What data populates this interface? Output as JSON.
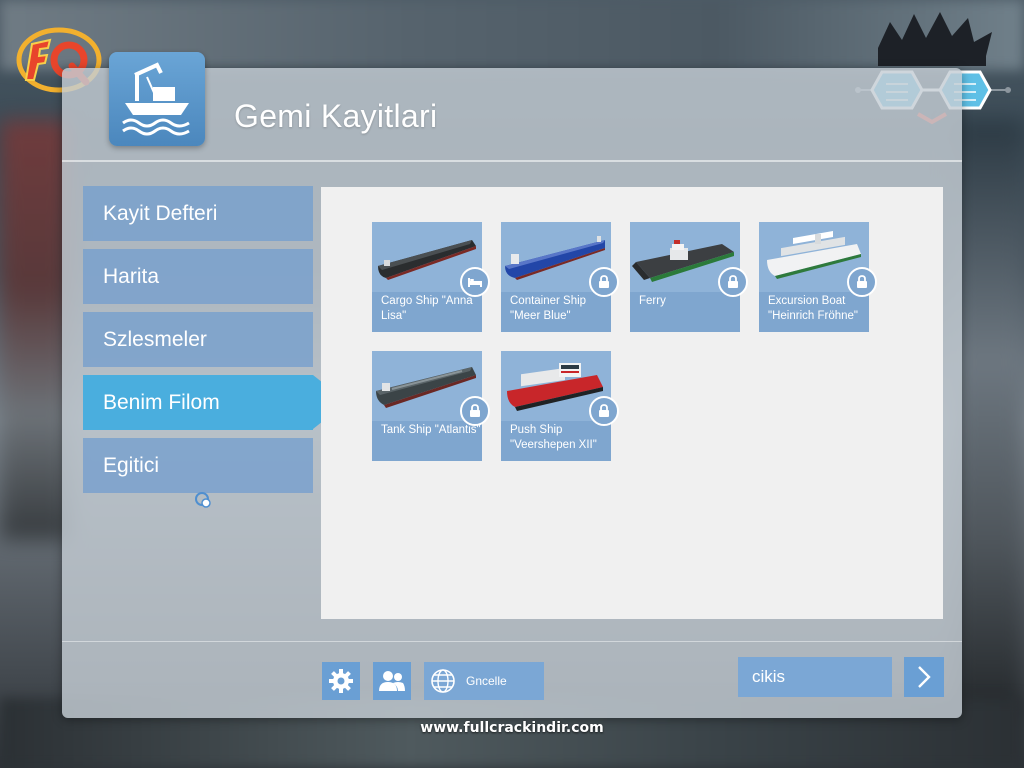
{
  "window": {
    "title": "Gemi Kayitlari"
  },
  "sidebar": {
    "items": [
      {
        "label": "Kayit Defteri",
        "active": false
      },
      {
        "label": "Harita",
        "active": false
      },
      {
        "label": "Szlesmeler",
        "active": false
      },
      {
        "label": "Benim Filom",
        "active": true
      },
      {
        "label": "Egitici",
        "active": false
      }
    ]
  },
  "fleet": {
    "ships": [
      {
        "name": "Cargo Ship \"Anna Lisa\"",
        "status": "bed-icon"
      },
      {
        "name": "Container Ship \"Meer Blue\"",
        "status": "lock-icon"
      },
      {
        "name": "Ferry",
        "status": "lock-icon"
      },
      {
        "name": "Excursion Boat \"Heinrich Fröhne\"",
        "status": "lock-icon"
      },
      {
        "name": "Tank Ship \"Atlantis\"",
        "status": "lock-icon"
      },
      {
        "name": "Push Ship \"Veershepen XII\"",
        "status": "lock-icon"
      }
    ]
  },
  "footer": {
    "settings_icon": "gear-icon",
    "profile_icon": "users-icon",
    "update_label": "Gncelle",
    "update_icon": "globe-icon",
    "exit_label": "cikis",
    "next_icon": "chevron-right-icon"
  },
  "watermark": "www.fullcrackindir.com",
  "colors": {
    "sidebar_item": "#78a0cd",
    "sidebar_active": "#4aaede",
    "card": "#7fa6cf",
    "panel": "#f0f0f0",
    "button": "#6a9fd4"
  }
}
